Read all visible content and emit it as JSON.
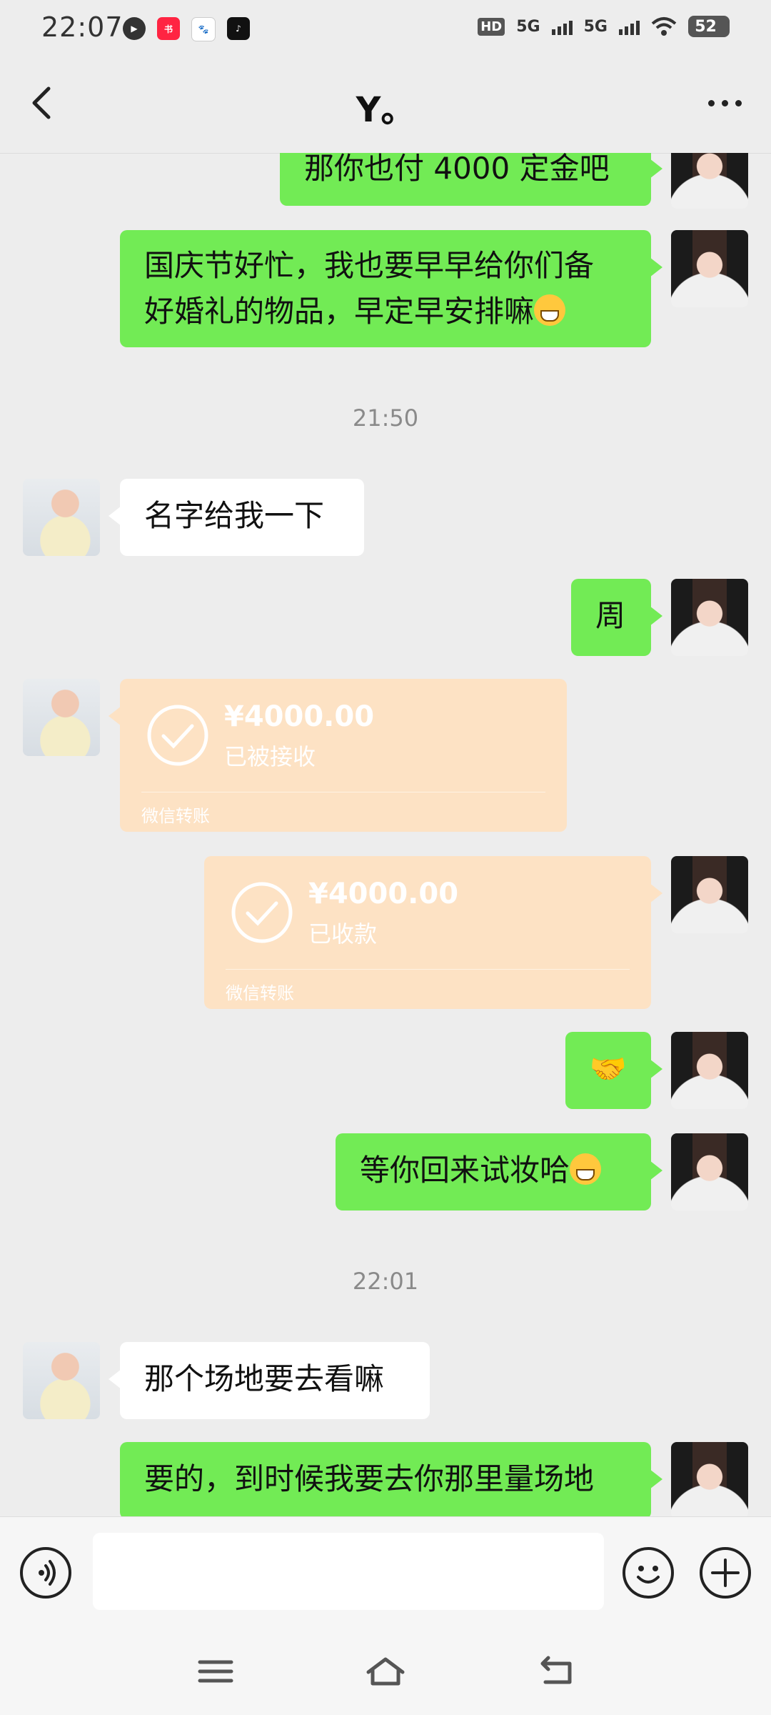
{
  "status_bar": {
    "time": "22:07",
    "battery": "52",
    "network_1": "5G",
    "network_2": "5G",
    "hd": "HD"
  },
  "header": {
    "title": "Y。"
  },
  "messages": [
    {
      "side": "me",
      "text": "那你也付 4000 定金吧"
    },
    {
      "side": "me",
      "text_line1": "国庆节好忙，我也要早早给你们备",
      "text_line2": "好婚礼的物品，早定早安排嘛"
    },
    {
      "timestamp": "21:50"
    },
    {
      "side": "other",
      "text": "名字给我一下"
    },
    {
      "side": "me",
      "text": "周"
    },
    {
      "side": "other",
      "type": "transfer",
      "amount": "¥4000.00",
      "status": "已被接收",
      "label": "微信转账"
    },
    {
      "side": "me",
      "type": "transfer",
      "amount": "¥4000.00",
      "status": "已收款",
      "label": "微信转账"
    },
    {
      "side": "me",
      "type": "emoji",
      "emoji": "🤝"
    },
    {
      "side": "me",
      "text": "等你回来试妆哈"
    },
    {
      "timestamp": "22:01"
    },
    {
      "side": "other",
      "text": "那个场地要去看嘛"
    },
    {
      "side": "me",
      "text": "要的，到时候我要去你那里量场地"
    }
  ],
  "icons": {
    "back": "chevron-left-icon",
    "more": "more-dots-icon",
    "voice": "voice-input-icon",
    "emoji": "emoji-icon",
    "plus": "plus-icon",
    "nav_menu": "menu-icon",
    "nav_home": "home-icon",
    "nav_back": "back-icon"
  },
  "colors": {
    "my_bubble": "#72eb55",
    "other_bubble": "#ffffff",
    "transfer": "#fde2c4",
    "background": "#ededed"
  }
}
